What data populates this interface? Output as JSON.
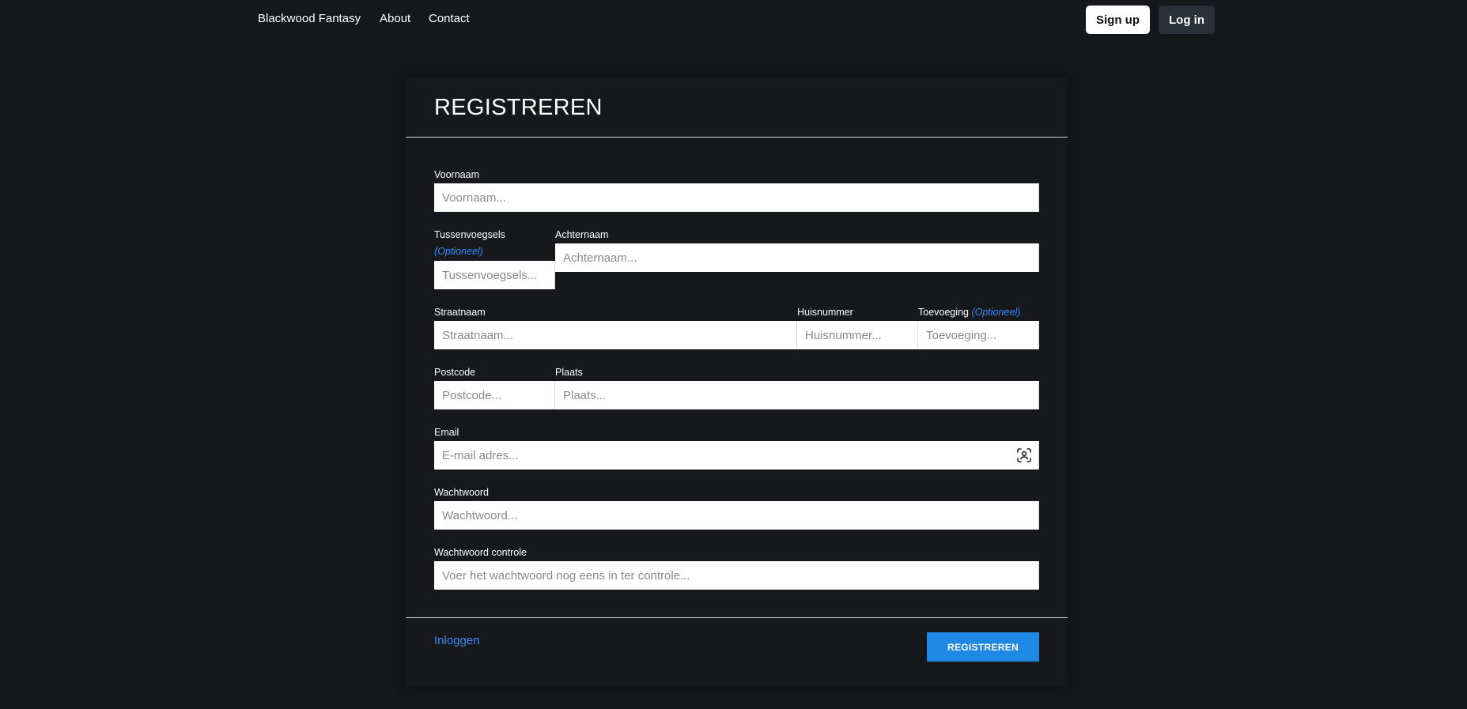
{
  "nav": {
    "brand": "Blackwood Fantasy",
    "about": "About",
    "contact": "Contact",
    "signup": "Sign up",
    "login": "Log in"
  },
  "form": {
    "title": "REGISTREREN",
    "voornaam": {
      "label": "Voornaam",
      "placeholder": "Voornaam..."
    },
    "tussenvoegsels": {
      "label": "Tussenvoegsels",
      "optional": "(Optioneel)",
      "placeholder": "Tussenvoegsels..."
    },
    "achternaam": {
      "label": "Achternaam",
      "placeholder": "Achternaam..."
    },
    "straatnaam": {
      "label": "Straatnaam",
      "placeholder": "Straatnaam..."
    },
    "huisnummer": {
      "label": "Huisnummer",
      "placeholder": "Huisnummer..."
    },
    "toevoeging": {
      "label": "Toevoeging",
      "optional": "(Optioneel)",
      "placeholder": "Toevoeging..."
    },
    "postcode": {
      "label": "Postcode",
      "placeholder": "Postcode..."
    },
    "plaats": {
      "label": "Plaats",
      "placeholder": "Plaats..."
    },
    "email": {
      "label": "Email",
      "placeholder": "E-mail adres...",
      "icon": "contact-card-icon"
    },
    "wachtwoord": {
      "label": "Wachtwoord",
      "placeholder": "Wachtwoord..."
    },
    "wachtwoord_controle": {
      "label": "Wachtwoord controle",
      "placeholder": "Voer het wachtwoord nog eens in ter controle..."
    },
    "login_link": "Inloggen",
    "submit": "REGISTREREN"
  },
  "colors": {
    "background": "#15171b",
    "accent": "#1e88e5",
    "link": "#2f8cff"
  }
}
